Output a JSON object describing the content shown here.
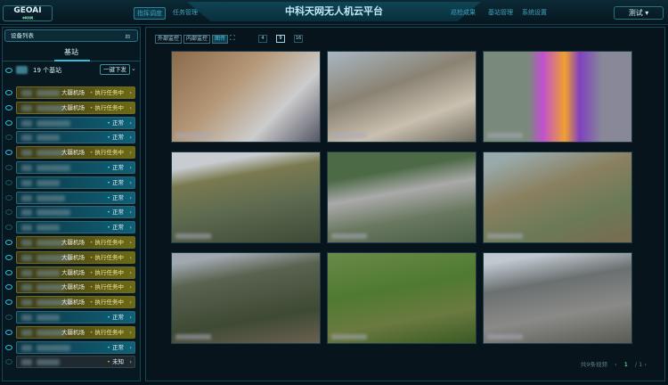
{
  "header": {
    "logo": "GEOAI",
    "logo_sub": "中科天网",
    "title": "中科天网无人机云平台",
    "nav_left": [
      "指挥调度",
      "任务管理"
    ],
    "nav_right": [
      "巡检成果",
      "基站管理",
      "系统设置"
    ],
    "user": "测试"
  },
  "sidebar": {
    "title": "设备列表",
    "tab": "基站",
    "count_label": "19 个基站",
    "dispatch_button": "一键下发",
    "items": [
      {
        "name": "大疆机场",
        "status": "执行任务中",
        "type": "busy",
        "eye": true
      },
      {
        "name": "大疆机场",
        "status": "执行任务中",
        "type": "busy",
        "eye": true
      },
      {
        "name": "",
        "status": "正常",
        "type": "ok",
        "eye": true
      },
      {
        "name": "",
        "status": "正常",
        "type": "ok",
        "eye": false
      },
      {
        "name": "大疆机场",
        "status": "执行任务中",
        "type": "busy",
        "eye": true
      },
      {
        "name": "",
        "status": "正常",
        "type": "ok",
        "eye": false
      },
      {
        "name": "",
        "status": "正常",
        "type": "ok",
        "eye": false
      },
      {
        "name": "",
        "status": "正常",
        "type": "ok",
        "eye": false
      },
      {
        "name": "",
        "status": "正常",
        "type": "ok",
        "eye": false
      },
      {
        "name": "",
        "status": "正常",
        "type": "ok",
        "eye": false
      },
      {
        "name": "大疆机场",
        "status": "执行任务中",
        "type": "busy",
        "eye": true
      },
      {
        "name": "大疆机场",
        "status": "执行任务中",
        "type": "busy",
        "eye": true
      },
      {
        "name": "大疆机场",
        "status": "执行任务中",
        "type": "busy",
        "eye": true
      },
      {
        "name": "大疆机场",
        "status": "执行任务中",
        "type": "busy",
        "eye": true
      },
      {
        "name": "大疆机场",
        "status": "执行任务中",
        "type": "busy",
        "eye": true
      },
      {
        "name": "",
        "status": "正常",
        "type": "ok",
        "eye": false
      },
      {
        "name": "大疆机场",
        "status": "执行任务中",
        "type": "busy",
        "eye": true
      },
      {
        "name": "",
        "status": "正常",
        "type": "ok",
        "eye": true
      },
      {
        "name": "",
        "status": "未知",
        "type": "unk",
        "eye": false
      }
    ]
  },
  "toolbar": {
    "tabs": [
      "外部监控",
      "内部监控",
      "图传"
    ],
    "selected_tab": "图传",
    "grid_options": [
      "4",
      "9",
      "16"
    ],
    "selected_grid": "9"
  },
  "videos": [
    "construction-hillside",
    "town-rooftops",
    "thermal-overlay",
    "fish-ponds",
    "reservoir-village",
    "village-fields",
    "forest-hills",
    "farmland-tower",
    "highway"
  ],
  "footer": {
    "count": "共9条视频",
    "page": "1",
    "total": "/ 1"
  }
}
